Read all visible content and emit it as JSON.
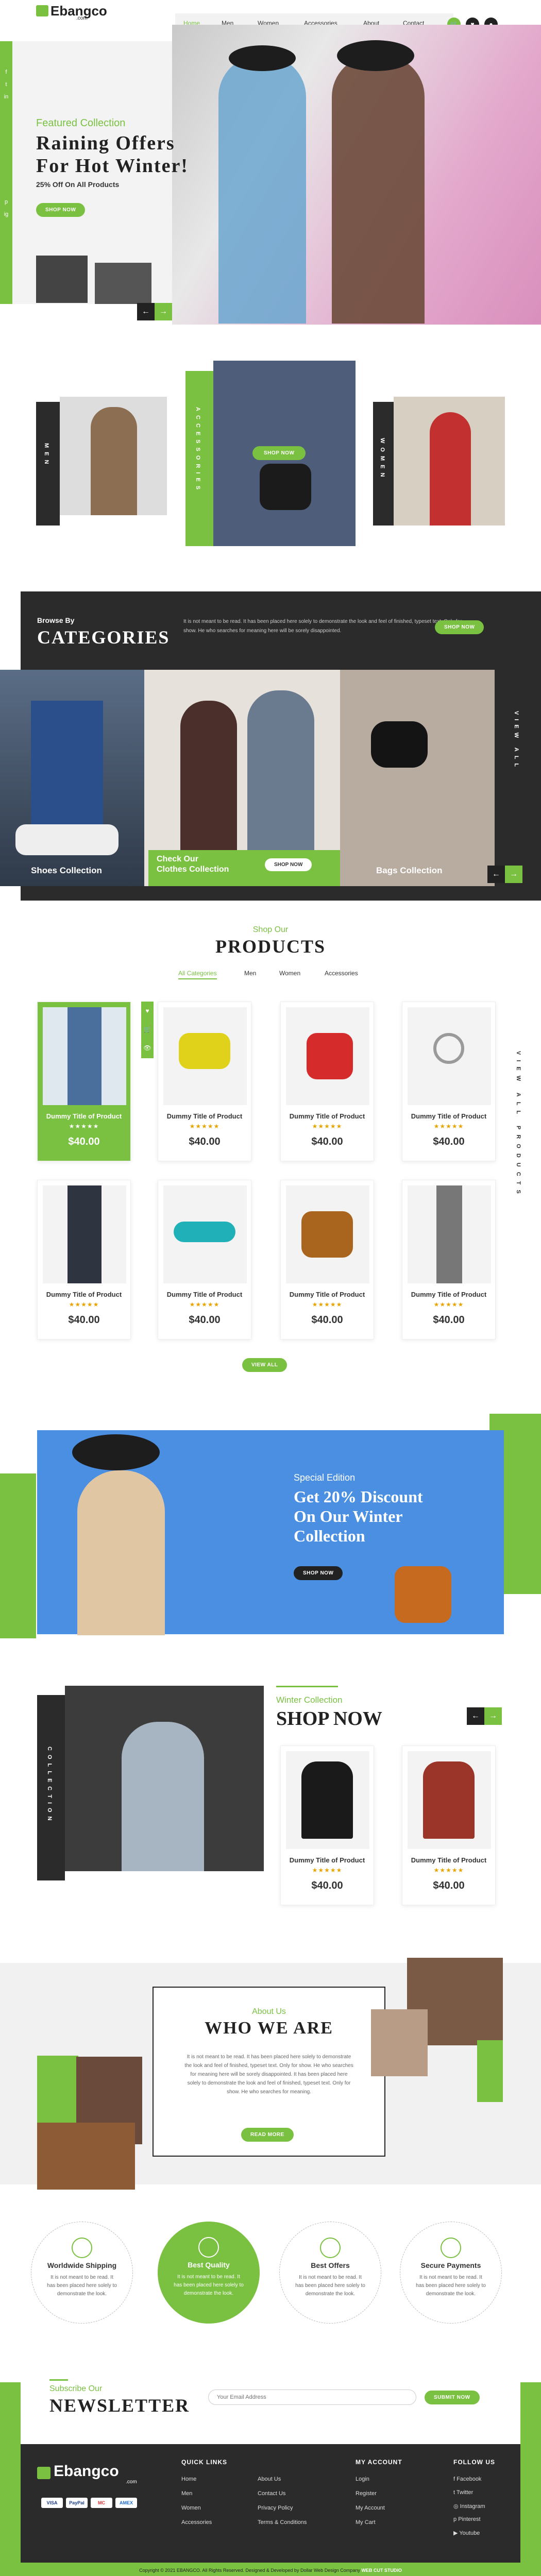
{
  "header": {
    "logo_main": "Ebangco",
    "logo_sub": ".com",
    "nav": [
      "Home",
      "Men",
      "Women",
      "Accessories",
      "About",
      "Contact"
    ],
    "icons": [
      "cart-icon",
      "heart-icon",
      "user-icon"
    ]
  },
  "hero": {
    "kicker": "Featured Collection",
    "title_line1": "Raining Offers",
    "title_line2": "For Hot Winter!",
    "subtitle": "25% Off On All Products",
    "button": "SHOP NOW",
    "social": [
      "f",
      "t",
      "in",
      "p",
      "ig"
    ],
    "arrows": [
      "←",
      "→"
    ]
  },
  "collections": {
    "men": "MEN",
    "accessories": "ACCESSORIES",
    "women": "WOMEN",
    "button": "SHOP NOW"
  },
  "categories": {
    "kicker": "Browse By",
    "title": "CATEGORIES",
    "text": "It is not meant to be read. It has been placed here solely to demonstrate the look and feel of finished, typeset text. Only for show. He who searches for meaning here will be sorely disappointed.",
    "button": "SHOP NOW",
    "view_all": "VIEW ALL",
    "tile1": "Shoes Collection",
    "tile2_line1": "Check Our",
    "tile2_line2": "Clothes Collection",
    "tile2_button": "SHOP NOW",
    "tile3": "Bags Collection"
  },
  "products": {
    "kicker": "Shop Our",
    "title": "PRODUCTS",
    "tabs": [
      "All Categories",
      "Men",
      "Women",
      "Accessories"
    ],
    "side": "VIEW ALL PRODUCTS",
    "items": [
      {
        "title": "Dummy Title of Product",
        "stars": "★★★★★",
        "price": "$40.00"
      },
      {
        "title": "Dummy Title of Product",
        "stars": "★★★★★",
        "price": "$40.00"
      },
      {
        "title": "Dummy Title of Product",
        "stars": "★★★★★",
        "price": "$40.00"
      },
      {
        "title": "Dummy Title of Product",
        "stars": "★★★★★",
        "price": "$40.00"
      },
      {
        "title": "Dummy Title of Product",
        "stars": "★★★★★",
        "price": "$40.00"
      },
      {
        "title": "Dummy Title of Product",
        "stars": "★★★★★",
        "price": "$40.00"
      },
      {
        "title": "Dummy Title of Product",
        "stars": "★★★★★",
        "price": "$40.00"
      },
      {
        "title": "Dummy Title of Product",
        "stars": "★★★★★",
        "price": "$40.00"
      }
    ],
    "view_all": "VIEW ALL"
  },
  "special": {
    "kicker": "Special Edition",
    "line1": "Get 20% Discount",
    "line2": "On Our Winter",
    "line3": "Collection",
    "button": "SHOP NOW"
  },
  "winter": {
    "side": "COLLECTION",
    "kicker": "Winter Collection",
    "title": "SHOP NOW",
    "items": [
      {
        "title": "Dummy Title of Product",
        "stars": "★★★★★",
        "price": "$40.00"
      },
      {
        "title": "Dummy Title of Product",
        "stars": "★★★★★",
        "price": "$40.00"
      }
    ]
  },
  "about": {
    "kicker": "About Us",
    "title": "WHO WE ARE",
    "text": "It is not meant to be read. It has been placed here solely to demonstrate the look and feel of finished, typeset text. Only for show. He who searches for meaning here will be sorely disappointed. It has been placed here solely to demonstrate the look and feel of finished, typeset text. Only for show. He who searches for meaning.",
    "button": "READ MORE"
  },
  "features": [
    {
      "title": "Worldwide Shipping",
      "text": "It is not meant to be read. It has been placed here solely to demonstrate the look."
    },
    {
      "title": "Best Quality",
      "text": "It is not meant to be read. It has been placed here solely to demonstrate the look."
    },
    {
      "title": "Best Offers",
      "text": "It is not meant to be read. It has been placed here solely to demonstrate the look."
    },
    {
      "title": "Secure Payments",
      "text": "It is not meant to be read. It has been placed here solely to demonstrate the look."
    }
  ],
  "newsletter": {
    "kicker": "Subscribe Our",
    "title": "NEWSLETTER",
    "placeholder": "Your Email Address",
    "button": "SUBMIT NOW"
  },
  "footer": {
    "quick_links_title": "QUICK LINKS",
    "quick_col1": [
      "Home",
      "Men",
      "Women",
      "Accessories"
    ],
    "quick_col2": [
      "About Us",
      "Contact Us",
      "Privacy Policy",
      "Terms & Conditions"
    ],
    "account_title": "MY ACCOUNT",
    "account": [
      "Login",
      "Register",
      "My Account",
      "My Cart"
    ],
    "follow_title": "FOLLOW US",
    "follow": [
      "Facebook",
      "Twitter",
      "Instagram",
      "Pinterest",
      "Youtube"
    ],
    "payments": [
      "VISA",
      "PayPal",
      "MC",
      "AMEX"
    ],
    "copyright": "Copyright © 2021 EBANGCO. All Rights Reserved. Designed & Developed by Dollar Web Design Company",
    "copyright_link": "WEB CUT STUDIO"
  },
  "colors": {
    "accent": "#7ac142",
    "dark": "#2b2b2b",
    "blue": "#4a8fe2",
    "pink": "#e7b3cf"
  }
}
